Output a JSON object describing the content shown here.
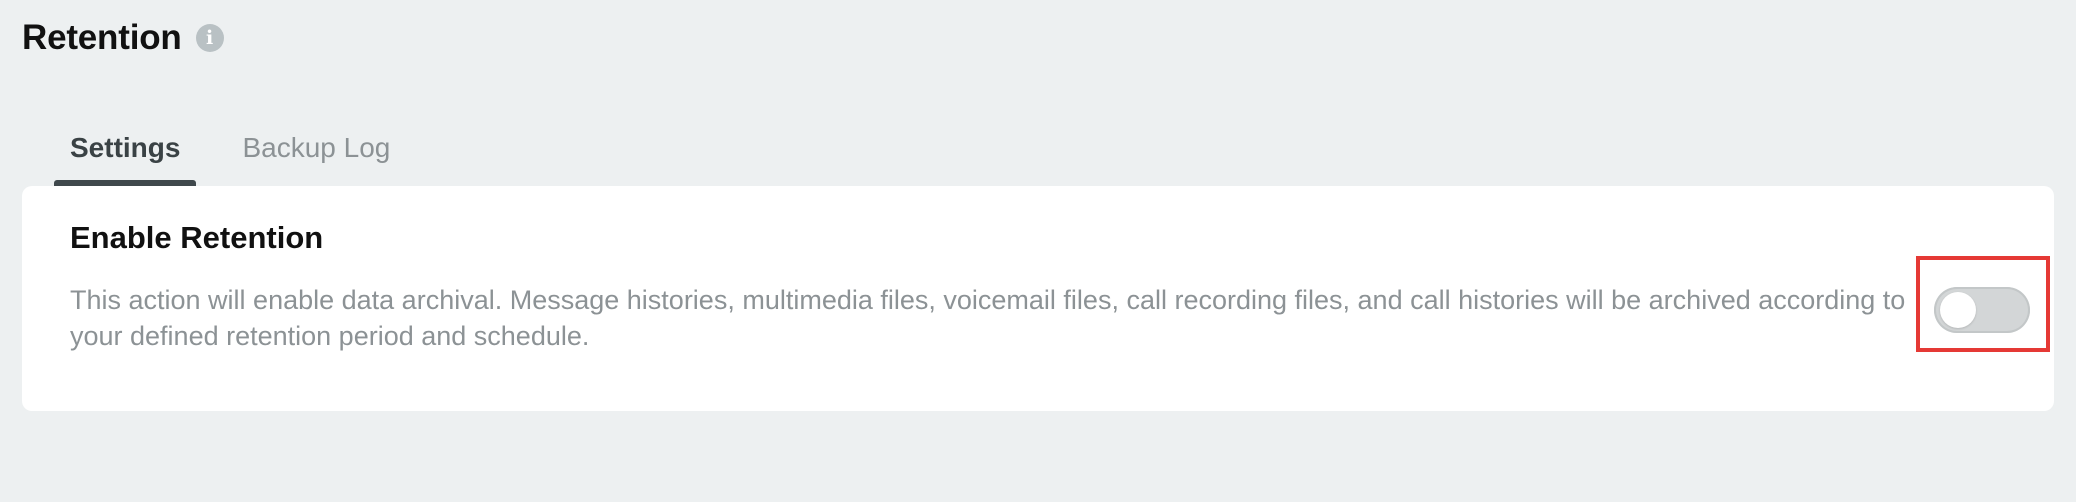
{
  "header": {
    "title": "Retention",
    "info_icon": "i"
  },
  "tabs": [
    {
      "label": "Settings",
      "active": true
    },
    {
      "label": "Backup Log",
      "active": false
    }
  ],
  "card": {
    "title": "Enable Retention",
    "description": "This action will enable data archival. Message histories, multimedia files, voicemail files, call recording files, and call histories will be archived according to your defined retention period and schedule.",
    "toggle": {
      "state": "off"
    }
  },
  "colors": {
    "background": "#edf0f1",
    "active_tab_indicator": "#3f484c",
    "highlight_border": "#e53935",
    "toggle_off": "#d3d6d7"
  }
}
